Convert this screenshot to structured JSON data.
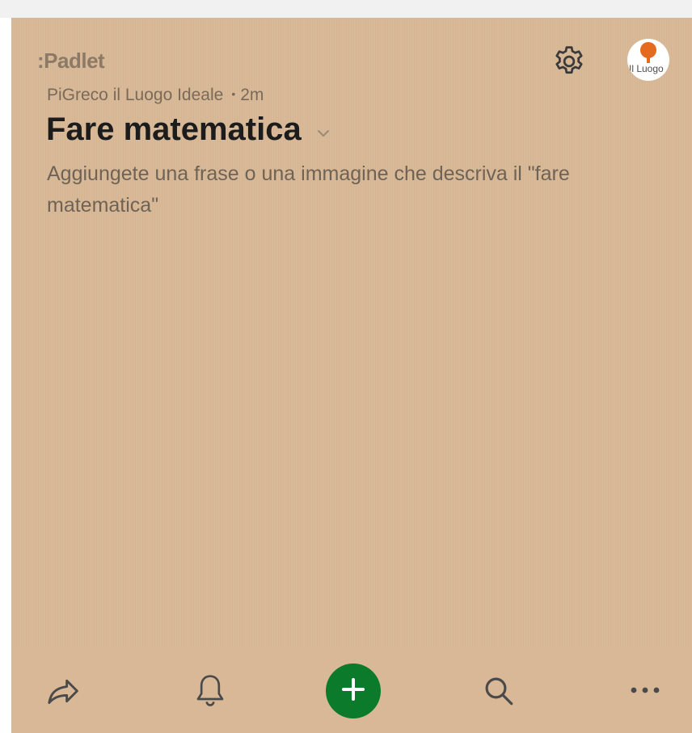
{
  "app": {
    "logo": ":Padlet"
  },
  "header": {
    "author": "PiGreco il Luogo Ideale",
    "separator": "•",
    "time_ago": "2m",
    "title": "Fare matematica",
    "description": "Aggiungete una frase o una immagine che descriva il \"fare matematica\""
  },
  "account": {
    "avatar_text": "Il Luogo"
  },
  "toolbar": {
    "icons": [
      "share-icon",
      "bell-icon",
      "plus-icon",
      "search-icon",
      "more-icon"
    ]
  },
  "colors": {
    "board_background": "#d8b896",
    "add_button": "#0b7a2a",
    "avatar_pin": "#e46a1f"
  }
}
